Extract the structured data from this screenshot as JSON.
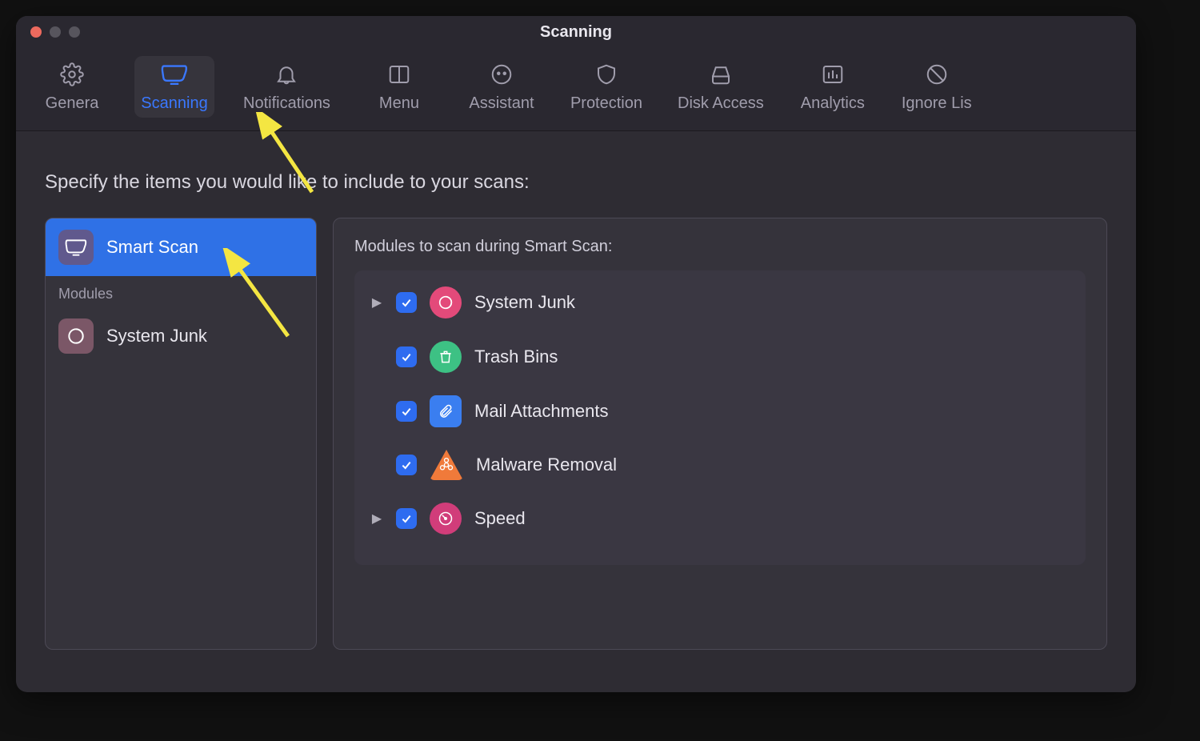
{
  "window": {
    "title": "Scanning"
  },
  "toolbar": {
    "tabs": [
      {
        "id": "general",
        "label": "Genera",
        "icon": "gear-icon",
        "active": false
      },
      {
        "id": "scanning",
        "label": "Scanning",
        "icon": "monitor-icon",
        "active": true
      },
      {
        "id": "notifications",
        "label": "Notifications",
        "icon": "bell-icon",
        "active": false
      },
      {
        "id": "menu",
        "label": "Menu",
        "icon": "layout-icon",
        "active": false
      },
      {
        "id": "assistant",
        "label": "Assistant",
        "icon": "face-icon",
        "active": false
      },
      {
        "id": "protection",
        "label": "Protection",
        "icon": "shield-icon",
        "active": false
      },
      {
        "id": "disk-access",
        "label": "Disk Access",
        "icon": "disk-icon",
        "active": false
      },
      {
        "id": "analytics",
        "label": "Analytics",
        "icon": "chart-icon",
        "active": false
      },
      {
        "id": "ignore-list",
        "label": "Ignore Lis",
        "icon": "prohibit-icon",
        "active": false
      }
    ]
  },
  "main": {
    "instruction": "Specify the items you would like to include to your scans:",
    "sidebar": {
      "items": [
        {
          "id": "smart-scan",
          "label": "Smart Scan",
          "icon": "monitor-icon",
          "selected": true
        }
      ],
      "section_header": "Modules",
      "module_items": [
        {
          "id": "system-junk",
          "label": "System Junk",
          "icon": "swirl-icon",
          "selected": false
        }
      ]
    },
    "panel": {
      "title": "Modules to scan during Smart Scan:",
      "modules": [
        {
          "id": "system-junk",
          "label": "System Junk",
          "checked": true,
          "expandable": true,
          "icon": "swirl-icon",
          "color": "pink"
        },
        {
          "id": "trash-bins",
          "label": "Trash Bins",
          "checked": true,
          "expandable": false,
          "icon": "trash-icon",
          "color": "green"
        },
        {
          "id": "mail-attachments",
          "label": "Mail Attachments",
          "checked": true,
          "expandable": false,
          "icon": "paperclip-icon",
          "color": "blue"
        },
        {
          "id": "malware-removal",
          "label": "Malware Removal",
          "checked": true,
          "expandable": false,
          "icon": "biohazard-icon",
          "color": "orange"
        },
        {
          "id": "speed",
          "label": "Speed",
          "checked": true,
          "expandable": true,
          "icon": "gauge-icon",
          "color": "magenta"
        }
      ]
    }
  }
}
